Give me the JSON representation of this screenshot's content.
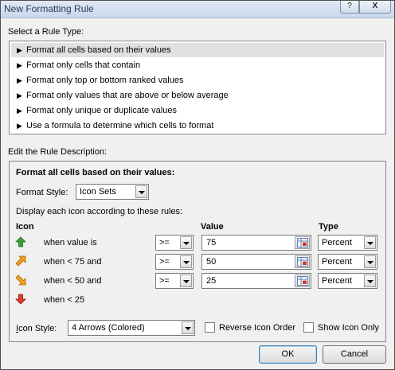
{
  "window": {
    "title": "New Formatting Rule"
  },
  "titlebar": {
    "help_label": "?",
    "close_label": "X"
  },
  "rule_type": {
    "heading": "Select a Rule Type:",
    "items": [
      {
        "label": "Format all cells based on their values",
        "selected": true
      },
      {
        "label": "Format only cells that contain",
        "selected": false
      },
      {
        "label": "Format only top or bottom ranked values",
        "selected": false
      },
      {
        "label": "Format only values that are above or below average",
        "selected": false
      },
      {
        "label": "Format only unique or duplicate values",
        "selected": false
      },
      {
        "label": "Use a formula to determine which cells to format",
        "selected": false
      }
    ]
  },
  "description": {
    "heading": "Edit the Rule Description:",
    "bold_title": "Format all cells based on their values:",
    "format_style_label": "Format Style:",
    "format_style_value": "Icon Sets",
    "display_rules_label": "Display each icon according to these rules:",
    "col_icon": "Icon",
    "col_value": "Value",
    "col_type": "Type",
    "rows": [
      {
        "icon": "green-up-arrow-icon",
        "condition": "when value is",
        "operator": ">=",
        "value": "75",
        "type": "Percent"
      },
      {
        "icon": "yellow-up-right-arrow-icon",
        "condition": "when < 75 and",
        "operator": ">=",
        "value": "50",
        "type": "Percent"
      },
      {
        "icon": "yellow-down-right-arrow-icon",
        "condition": "when < 50 and",
        "operator": ">=",
        "value": "25",
        "type": "Percent"
      },
      {
        "icon": "red-down-arrow-icon",
        "condition": "when < 25"
      }
    ],
    "icon_style_label": "Icon Style:",
    "icon_style_value": "4 Arrows (Colored)",
    "reverse_icon_order_label": "Reverse Icon Order",
    "show_icon_only_label": "Show Icon Only",
    "reverse_icon_order_checked": false,
    "show_icon_only_checked": false
  },
  "buttons": {
    "ok": "OK",
    "cancel": "Cancel"
  },
  "colors": {
    "green_arrow": "#3aa03a",
    "yellow_arrow": "#f0a01c",
    "red_arrow": "#e23a2a",
    "selection": "#e1e1e1"
  }
}
